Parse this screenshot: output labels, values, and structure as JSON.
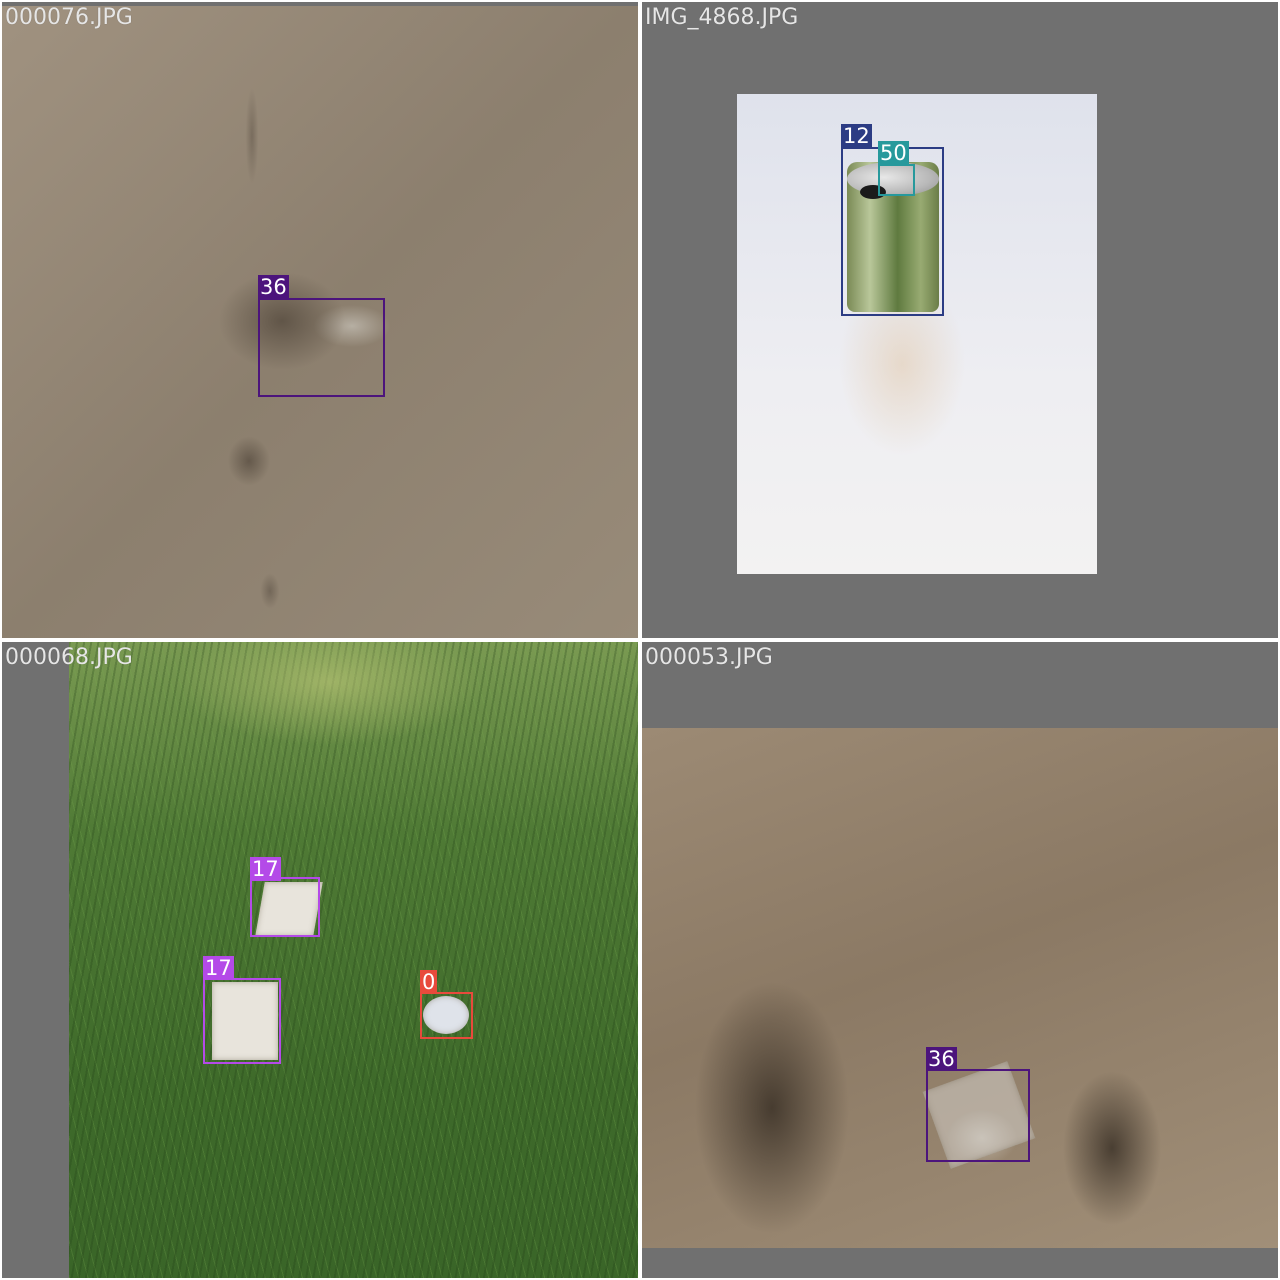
{
  "colors": {
    "class_0": "#e84a3c",
    "class_12": "#2c3c84",
    "class_17": "#b44ae8",
    "class_36": "#4c147c",
    "class_50": "#27999c",
    "tile_padding": "#707070"
  },
  "tiles": [
    {
      "filename": "000076.JPG",
      "detections": [
        {
          "class_id": "36"
        }
      ]
    },
    {
      "filename": "IMG_4868.JPG",
      "detections": [
        {
          "class_id": "12"
        },
        {
          "class_id": "50"
        }
      ]
    },
    {
      "filename": "000068.JPG",
      "detections": [
        {
          "class_id": "17"
        },
        {
          "class_id": "17"
        },
        {
          "class_id": "0"
        }
      ]
    },
    {
      "filename": "000053.JPG",
      "detections": [
        {
          "class_id": "36"
        }
      ]
    }
  ]
}
